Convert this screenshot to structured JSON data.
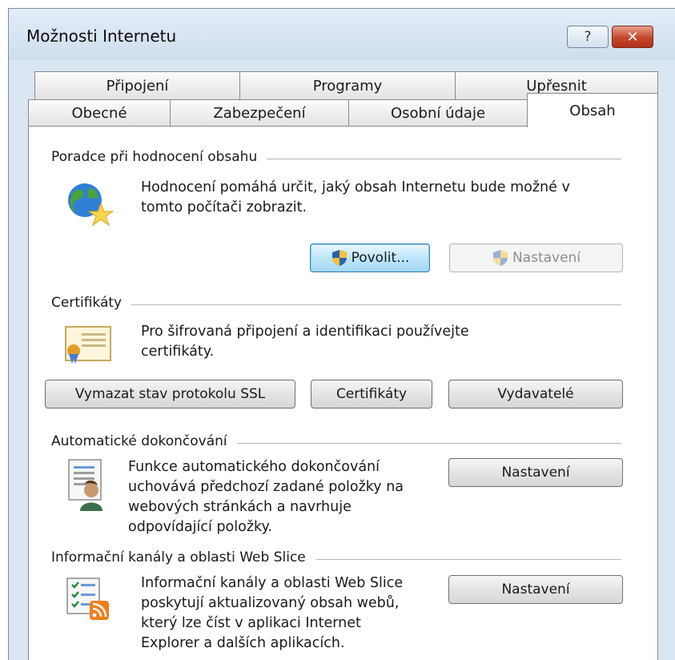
{
  "window": {
    "title": "Možnosti Internetu",
    "help_glyph": "?",
    "close_glyph": "✕"
  },
  "tabs": {
    "row_back": [
      "Připojení",
      "Programy",
      "Upřesnit"
    ],
    "row_front": [
      "Obecné",
      "Zabezpečení",
      "Osobní údaje",
      "Obsah"
    ],
    "active": "Obsah"
  },
  "sections": {
    "content_advisor": {
      "title": "Poradce při hodnocení obsahu",
      "description_line1": "Hodnocení pomáhá určit, jaký obsah Internetu bude možné v",
      "description_line2": "tomto počítači zobrazit.",
      "enable_label": "Povolit...",
      "settings_label": "Nastavení",
      "icon": "globe-star-icon"
    },
    "certificates": {
      "title": "Certifikáty",
      "description_line1": "Pro šifrovaná připojení a identifikaci používejte",
      "description_line2": "certifikáty.",
      "clear_ssl_label": "Vymazat stav protokolu SSL",
      "certificates_label": "Certifikáty",
      "publishers_label": "Vydavatelé",
      "icon": "certificate-icon"
    },
    "autocomplete": {
      "title": "Automatické dokončování",
      "description_lines": [
        "Funkce automatického dokončování",
        "uchovává předchozí zadané položky na",
        "webových stránkách a navrhuje",
        "odpovídající položky."
      ],
      "settings_label": "Nastavení",
      "icon": "autocomplete-user-icon"
    },
    "feeds": {
      "title": "Informační kanály a oblasti Web Slice",
      "description_lines": [
        "Informační kanály a oblasti Web Slice",
        "poskytují aktualizovaný obsah webů,",
        "který lze číst v aplikaci Internet",
        "Explorer a dalších aplikacích."
      ],
      "settings_label": "Nastavení",
      "icon": "rss-feed-icon"
    }
  }
}
